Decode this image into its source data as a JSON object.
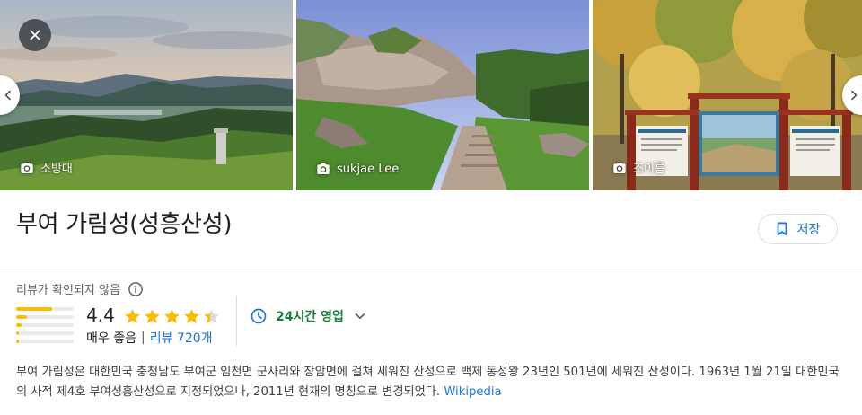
{
  "gallery": {
    "photos": [
      {
        "credit": "소방대"
      },
      {
        "credit": "sukjae Lee"
      },
      {
        "credit": "조이름"
      }
    ],
    "icons": {
      "close": "close-icon",
      "prev": "chevron-left-icon",
      "next": "chevron-right-icon",
      "camera": "camera-icon"
    }
  },
  "place": {
    "title": "부여 가림성(성흥산성)",
    "save_label": "저장"
  },
  "reviews": {
    "note": "리뷰가 확인되지 않음",
    "rating": "4.4",
    "rating_value": 4.4,
    "rating_max": 5,
    "rating_word": "매우 좋음",
    "separator": "|",
    "review_count_label": "리뷰 720개",
    "distribution": [
      0.62,
      0.18,
      0.1,
      0.05,
      0.05
    ]
  },
  "hours": {
    "label": "24시간 영업"
  },
  "description": {
    "text": "부여 가림성은 대한민국 충청남도 부여군 임천면 군사리와 장암면에 걸쳐 세워진 산성으로 백제 동성왕 23년인 501년에 세워진 산성이다. 1963년 1월 21일 대한민국의 사적 제4호 부여성흥산성으로 지정되었으나, 2011년 현재의 명칭으로 변경되었다.",
    "source_link": "Wikipedia"
  },
  "colors": {
    "accent": "#1a73e8",
    "star": "#fbbc04",
    "open": "#188038"
  }
}
